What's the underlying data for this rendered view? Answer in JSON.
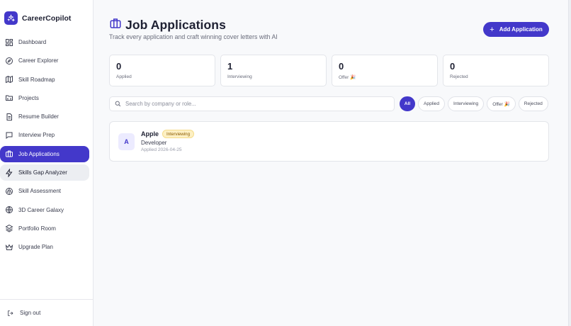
{
  "brand": {
    "name": "CareerCopilot",
    "logo_icon": "sparkles-icon",
    "accent": "#4338ca"
  },
  "sidebar": {
    "items": [
      {
        "label": "Dashboard",
        "icon": "dashboard-icon"
      },
      {
        "label": "Career Explorer",
        "icon": "compass-icon"
      },
      {
        "label": "Skill Roadmap",
        "icon": "map-icon"
      },
      {
        "label": "Projects",
        "icon": "folder-icon"
      },
      {
        "label": "Resume Builder",
        "icon": "document-icon"
      },
      {
        "label": "Interview Prep",
        "icon": "chat-icon"
      },
      {
        "label": "Job Applications",
        "icon": "briefcase-icon",
        "state": "active"
      },
      {
        "label": "Skills Gap Analyzer",
        "icon": "lightning-icon",
        "state": "hover"
      },
      {
        "label": "Skill Assessment",
        "icon": "brain-icon"
      },
      {
        "label": "3D Career Galaxy",
        "icon": "globe-icon"
      },
      {
        "label": "Portfolio Room",
        "icon": "layers-icon"
      },
      {
        "label": "Upgrade Plan",
        "icon": "crown-icon"
      }
    ],
    "sign_out": "Sign out"
  },
  "header": {
    "title": "Job Applications",
    "subtitle": "Track every application and craft winning cover letters with AI",
    "add_button": "Add Application"
  },
  "stats": [
    {
      "value": "0",
      "label": "Applied"
    },
    {
      "value": "1",
      "label": "Interviewing"
    },
    {
      "value": "0",
      "label": "Offer 🎉"
    },
    {
      "value": "0",
      "label": "Rejected"
    }
  ],
  "search": {
    "placeholder": "Search by company or role...",
    "value": ""
  },
  "filters": [
    {
      "label": "All",
      "active": true
    },
    {
      "label": "Applied"
    },
    {
      "label": "Interviewing"
    },
    {
      "label": "Offer 🎉"
    },
    {
      "label": "Rejected"
    }
  ],
  "applications": [
    {
      "initial": "A",
      "company": "Apple",
      "status": "Interviewing",
      "role": "Developer",
      "applied": "Applied 2026-04-25"
    }
  ]
}
